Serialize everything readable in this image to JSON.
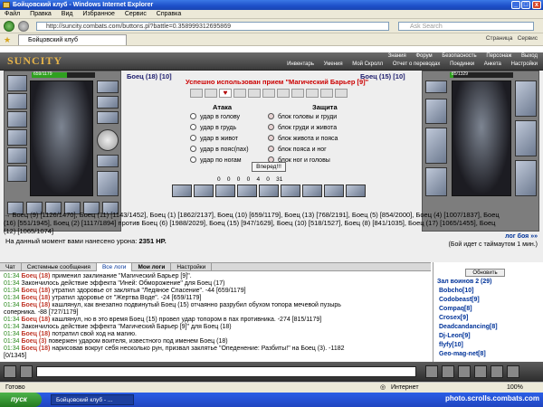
{
  "window_title": "Бойцовский клуб - Windows Internet Explorer",
  "menu": [
    "Файл",
    "Правка",
    "Вид",
    "Избранное",
    "Сервис",
    "Справка"
  ],
  "address": "http://suncity.combats.com/buttons.pl?battle=0.358999312695869",
  "search_placeholder": "Ask Search",
  "tab_label": "Бойцовский клуб",
  "tab_tools": [
    "Страница",
    "Сервис"
  ],
  "game": {
    "logo": "SUNCITY",
    "nav_top": [
      "Знания",
      "Форум",
      "Безопасность",
      "Персонаж",
      "Выход"
    ],
    "nav_bottom": [
      "Инвентарь",
      "Умения",
      "Мой Скролл",
      "Отчет о переводах",
      "Поединки",
      "Анкета",
      "Настройки"
    ]
  },
  "battle": {
    "left_name": "Боец (18)",
    "left_sub": "[10]",
    "right_name": "Боец (15)",
    "right_sub": "[10]",
    "left_hp": "659/1179",
    "right_hp": "85/1329",
    "left_hp_fraction": 0.56,
    "right_hp_fraction": 0.06,
    "used_msg": "Успешно использован прием \"Магический Барьер [9]\"",
    "attack_header": "Атака",
    "defense_header": "Защита",
    "attack_options": [
      "удар в голову",
      "удар в грудь",
      "удар в живот",
      "удар в пояс(пах)",
      "удар по ногам"
    ],
    "defense_options": [
      "блок головы и груди",
      "блок груди и живота",
      "блок живота и пояса",
      "блок пояса и ног",
      "блок ног и головы"
    ],
    "forward_btn": "Вперед!!!",
    "counters": [
      "0",
      "0",
      "0",
      "0",
      "4",
      "0",
      "31"
    ]
  },
  "fighters": {
    "line1": "→ Боец (9) [1126/1470], Боец (11) [1143/1452], Боец (1) [1862/2137], Боец (10) [659/1179], Боец (13) [768/2191], Боец (5) [854/2000], Боец (4) [1007/1837], Боец",
    "line2": "(16) [551/1945], Боец (2) [1117/1894]   против   Боец (6) [1988/2029], Боец (15) [947/1629], Боец (10) [518/1527], Боец (8) [841/1035], Боец (17) [1065/1455], Боец",
    "line3": "(12) [1065/1074]",
    "damage_text": "На данный момент вами нанесено урона:",
    "damage_value": "2351 HP.",
    "log_link": "лог боя »»",
    "timeout": "(Бой идет с таймаутом 1 мин.)"
  },
  "log_tabs": [
    "Чат",
    "Системные сообщения",
    "Все логи",
    "Мои логи",
    "Настройки"
  ],
  "log_lines": [
    {
      "t": "01:34",
      "n": "Боец (18)",
      "m": "применил заклинание \"Магический Барьер [9]\"."
    },
    {
      "t": "01:34",
      "n": "",
      "m": "Закончилось действие эффекта \"Иней: Обморожение\" для Боец (17)"
    },
    {
      "t": "01:34",
      "n": "Боец (18)",
      "m": "утратил здоровье от заклятья \"Ледяное Спасение\". -44 [659/1179]"
    },
    {
      "t": "01:34",
      "n": "Боец (18)",
      "m": "утратил здоровье от \"Жертва Воде\". -24 [659/1179]"
    },
    {
      "t": "01:34",
      "n": "Боец (18)",
      "m": "кашлянул, как внезапно подвинутый Боец (15) отчаянно разрубил обухом топора мечевой пузырь"
    },
    {
      "t": "",
      "n": "",
      "m": "соперника. -88 [727/1179]"
    },
    {
      "t": "01:34",
      "n": "Боец (18)",
      "m": "кашлянул, но в это время Боец (15) провел удар топором в пах противника. -274 [815/1179]"
    },
    {
      "t": "01:34",
      "n": "",
      "m": "Закончилось действие эффекта \"Магический Барьер [9]\" для Боец (18)"
    },
    {
      "t": "01:34",
      "n": "Боец (18)",
      "m": "потратил свой ход на магию."
    },
    {
      "t": "01:34",
      "n": "Боец (3)",
      "m": "повержен ударом воителя, известного под именем Боец (18)"
    },
    {
      "t": "01:34",
      "n": "Боец (18)",
      "m": "нарисовав вокруг себя несколько рун, призвал заклятье \"Опеденение: Разбиты!\" на Боец (3). -1182"
    },
    {
      "t": "",
      "n": "",
      "m": "[0/1345]"
    }
  ],
  "right_panel": {
    "update_btn": "Обновить",
    "room": "Зал воинов 2 (29)",
    "players": [
      "Bobcho[10]",
      "Codobeast[9]",
      "Compaq[8]",
      "Crosex[9]",
      "Deadcandancing[8]",
      "Dj-Leon[9]",
      "flyfy[10]",
      "Geo-mag-net[8]"
    ]
  },
  "status_left": "Готово",
  "status_zone": "Интернет",
  "status_zoom": "100%",
  "taskbar": {
    "start": "пуск",
    "task": "Бойцовский клуб - ..."
  },
  "watermark": "photo.scrolls.combats.com",
  "colors": {
    "accent": "#2c8a1e",
    "enemy": "#c0392b",
    "ally": "#4d4db3"
  }
}
